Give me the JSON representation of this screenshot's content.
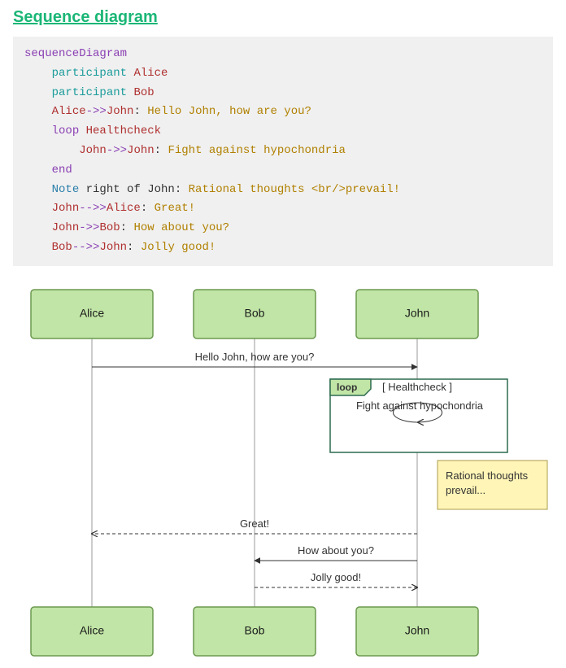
{
  "heading": "Sequence diagram",
  "code": {
    "l1_kw": "sequenceDiagram",
    "l2_ind": "    ",
    "l2_kw": "participant ",
    "l2_name": "Alice",
    "l3_ind": "    ",
    "l3_kw": "participant ",
    "l3_name": "Bob",
    "l4_ind": "    ",
    "l4_a": "Alice",
    "l4_op": "->>",
    "l4_b": "John",
    "l4_colon": ": ",
    "l4_msg": "Hello John, how are you?",
    "l5_ind": "    ",
    "l5_kw": "loop ",
    "l5_label": "Healthcheck",
    "l6_ind": "        ",
    "l6_a": "John",
    "l6_op": "->>",
    "l6_b": "John",
    "l6_colon": ": ",
    "l6_msg": "Fight against hypochondria",
    "l7_ind": "    ",
    "l7_kw": "end",
    "l8_ind": "    ",
    "l8_note": "Note",
    "l8_rest": " right of John: ",
    "l8_msg": "Rational thoughts <br/>prevail!",
    "l9_ind": "    ",
    "l9_a": "John",
    "l9_op": "-->>",
    "l9_b": "Alice",
    "l9_colon": ": ",
    "l9_msg": "Great!",
    "l10_ind": "    ",
    "l10_a": "John",
    "l10_op": "->>",
    "l10_b": "Bob",
    "l10_colon": ": ",
    "l10_msg": "How about you?",
    "l11_ind": "    ",
    "l11_a": "Bob",
    "l11_op": "-->>",
    "l11_b": "John",
    "l11_colon": ": ",
    "l11_msg": "Jolly good!"
  },
  "chart_data": {
    "type": "sequence-diagram",
    "participants": [
      "Alice",
      "Bob",
      "John"
    ],
    "messages": [
      {
        "from": "Alice",
        "to": "John",
        "label": "Hello John, how are you?",
        "style": "solid"
      },
      {
        "type": "loop",
        "label": "Healthcheck",
        "messages": [
          {
            "from": "John",
            "to": "John",
            "label": "Fight against hypochondria",
            "style": "solid"
          }
        ]
      },
      {
        "type": "note",
        "position": "right of John",
        "text": "Rational thoughts prevail..."
      },
      {
        "from": "John",
        "to": "Alice",
        "label": "Great!",
        "style": "dashed"
      },
      {
        "from": "John",
        "to": "Bob",
        "label": "How about you?",
        "style": "solid"
      },
      {
        "from": "Bob",
        "to": "John",
        "label": "Jolly good!",
        "style": "dashed"
      }
    ]
  },
  "diagram": {
    "actors_top": {
      "alice": "Alice",
      "bob": "Bob",
      "john": "John"
    },
    "actors_bottom": {
      "alice": "Alice",
      "bob": "Bob",
      "john": "John"
    },
    "msg1": "Hello John, how are you?",
    "loop_tag": "loop",
    "loop_title": "[ Healthcheck ]",
    "loop_msg": "Fight against hypochondria",
    "note_l1": "Rational thoughts",
    "note_l2": "prevail...",
    "msg_great": "Great!",
    "msg_how": "How about you?",
    "msg_jolly": "Jolly good!"
  }
}
